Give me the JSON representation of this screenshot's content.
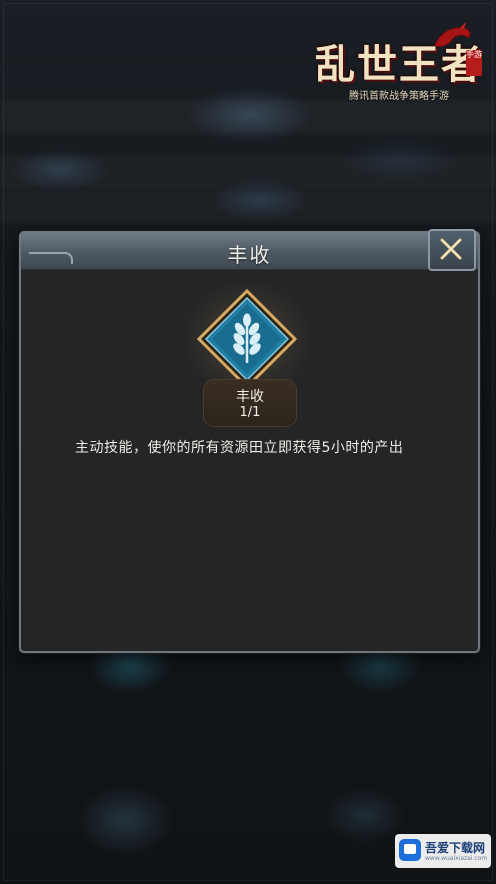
{
  "logo": {
    "title": "乱世王者",
    "subtitle": "腾讯首款战争策略手游",
    "stamp": "手游"
  },
  "dialog": {
    "title": "丰收",
    "close_icon": "close-x-icon"
  },
  "skill": {
    "icon": "wheat-skill-icon",
    "name": "丰收",
    "level": "1/1",
    "description": "主动技能，使你的所有资源田立即获得5小时的产出"
  },
  "watermark": {
    "name": "吾爱下载网",
    "url": "www.wuaixiazai.com"
  },
  "colors": {
    "dialog_bg": "#242527",
    "header": "#5a6570",
    "icon_teal": "#1f7ea1",
    "icon_gold": "#d6aa60",
    "text": "#f0ede6"
  }
}
